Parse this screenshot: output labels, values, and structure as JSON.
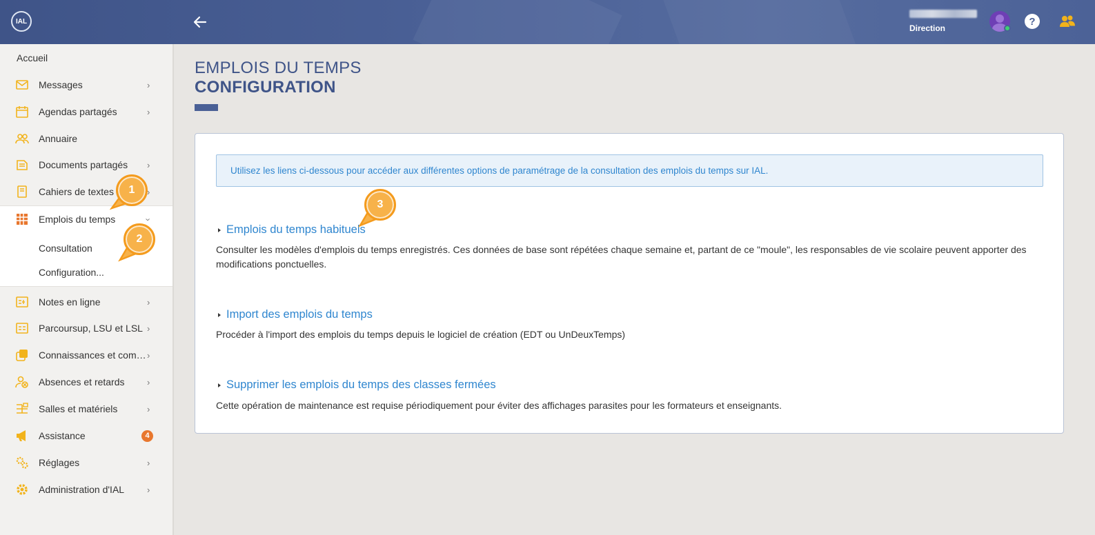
{
  "header": {
    "logo_text": "IAL",
    "user_role": "Direction",
    "help_label": "?"
  },
  "sidebar": {
    "home": "Accueil",
    "items": [
      {
        "label": "Messages",
        "icon": "messages-icon"
      },
      {
        "label": "Agendas partagés",
        "icon": "calendar-icon"
      },
      {
        "label": "Annuaire",
        "icon": "directory-icon"
      },
      {
        "label": "Documents partagés",
        "icon": "documents-icon"
      },
      {
        "label": "Cahiers de textes",
        "icon": "notebook-icon"
      },
      {
        "label": "Emplois du temps",
        "icon": "timetable-icon"
      },
      {
        "label": "Notes en ligne",
        "icon": "grades-icon"
      },
      {
        "label": "Parcoursup, LSU et LSL",
        "icon": "parcoursup-icon"
      },
      {
        "label": "Connaissances et compétences",
        "icon": "skills-icon"
      },
      {
        "label": "Absences et retards",
        "icon": "absences-icon"
      },
      {
        "label": "Salles et matériels",
        "icon": "rooms-icon"
      },
      {
        "label": "Assistance",
        "icon": "megaphone-icon",
        "badge": "4"
      },
      {
        "label": "Réglages",
        "icon": "settings-icon"
      },
      {
        "label": "Administration d'IAL",
        "icon": "admin-gear-icon"
      }
    ],
    "subitems": [
      "Consultation",
      "Configuration..."
    ]
  },
  "main": {
    "title_line1": "EMPLOIS DU TEMPS",
    "title_line2": "CONFIGURATION",
    "info": "Utilisez les liens ci-dessous pour accéder aux différentes options de paramétrage de la consultation des emplois du temps sur IAL.",
    "sections": [
      {
        "link": "Emplois du temps habituels",
        "desc": "Consulter les modèles d'emplois du temps enregistrés. Ces données de base sont répétées chaque semaine et, partant de ce \"moule\", les responsables de vie scolaire peuvent apporter des modifications ponctuelles."
      },
      {
        "link": "Import des emplois du temps",
        "desc": "Procéder à l'import des emplois du temps depuis le logiciel de création (EDT ou UnDeuxTemps)"
      },
      {
        "link": "Supprimer les emplois du temps des classes fermées",
        "desc": "Cette opération de maintenance est requise périodiquement pour éviter des affichages parasites pour les formateurs et enseignants."
      }
    ]
  },
  "callouts": [
    "1",
    "2",
    "3"
  ],
  "colors": {
    "accent": "#4a6096",
    "link": "#2f86cf",
    "icon_yellow": "#f2b31b",
    "badge": "#e8772e",
    "callout": "#f7b24a"
  }
}
